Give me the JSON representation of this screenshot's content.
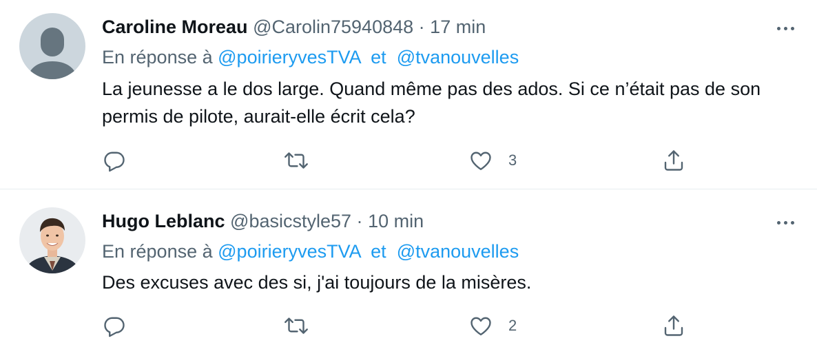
{
  "tweets": [
    {
      "display_name": "Caroline Moreau",
      "handle": "@Carolin75940848",
      "separator": "·",
      "time": "17 min",
      "reply_prefix": "En réponse à",
      "reply_mentions": [
        "@poirieryvesTVA",
        "@tvanouvelles"
      ],
      "reply_and": "et",
      "text": "La jeunesse a le dos large. Quand même pas des ados.  Si ce n’était pas de son permis de pilote, aurait-elle écrit cela?",
      "likes": "3",
      "avatar": "default-profile-icon"
    },
    {
      "display_name": "Hugo Leblanc",
      "handle": "@basicstyle57",
      "separator": "·",
      "time": "10 min",
      "reply_prefix": "En réponse à",
      "reply_mentions": [
        "@poirieryvesTVA",
        "@tvanouvelles"
      ],
      "reply_and": "et",
      "text": "Des excuses avec des si, j'ai toujours de la misères.",
      "likes": "2",
      "avatar": "user-photo"
    }
  ],
  "icons": {
    "reply": "reply-icon",
    "retweet": "retweet-icon",
    "like": "heart-icon",
    "share": "share-icon",
    "more": "more-icon"
  },
  "colors": {
    "link": "#1d9bf0",
    "secondary_text": "#536471",
    "primary_text": "#0f1419",
    "divider": "#e6ecf0"
  }
}
